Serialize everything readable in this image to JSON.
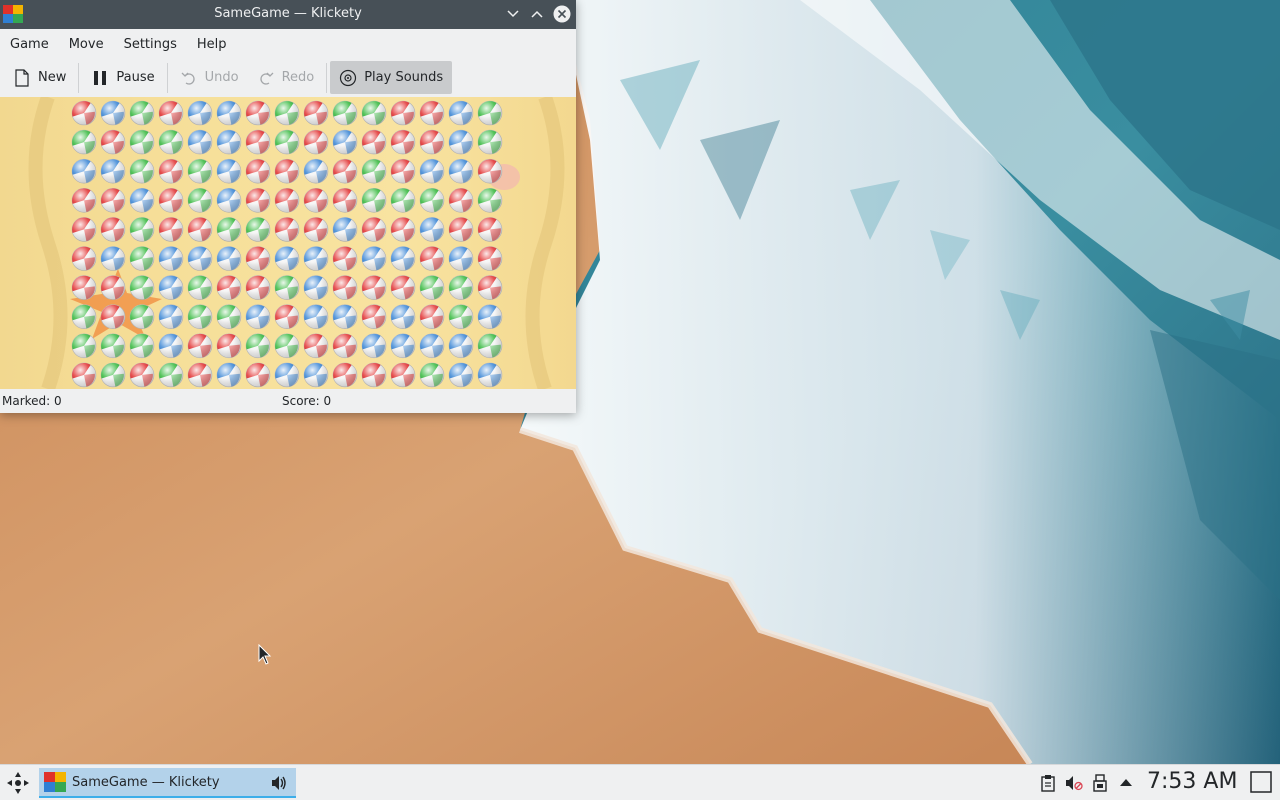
{
  "window": {
    "title": "SameGame — Klickety",
    "menu": [
      "Game",
      "Move",
      "Settings",
      "Help"
    ],
    "toolbar": {
      "new": "New",
      "pause": "Pause",
      "undo": "Undo",
      "redo": "Redo",
      "play_sounds": "Play Sounds"
    },
    "status": {
      "marked": "Marked: 0",
      "score": "Score: 0"
    }
  },
  "board": {
    "rows": [
      "RBGRBBRGRGGRRBG",
      "GRGGBBRGRBRRRBG",
      "BBGRGBRRBRGRBBR",
      "RRBRGBRRRRGGGRG",
      "RRGRRGGRRBRRBRR",
      "RBGBBBRBBRBBRBR",
      "RRGBGRRGBRRRGGR",
      "GRGBGGBRBBRBRGB",
      "GGGBRRGGRRBBBBG",
      "RGRGRBRBBRRRGBB"
    ],
    "colors": {
      "R": "#e02424",
      "G": "#2bb534",
      "B": "#2f7fd3"
    }
  },
  "taskbar": {
    "task_label": "SameGame — Klickety",
    "clock": "7:53 AM"
  },
  "colors": {
    "accent": "#3daee9",
    "titlebar": "#475057",
    "panel": "#eff0f1"
  }
}
